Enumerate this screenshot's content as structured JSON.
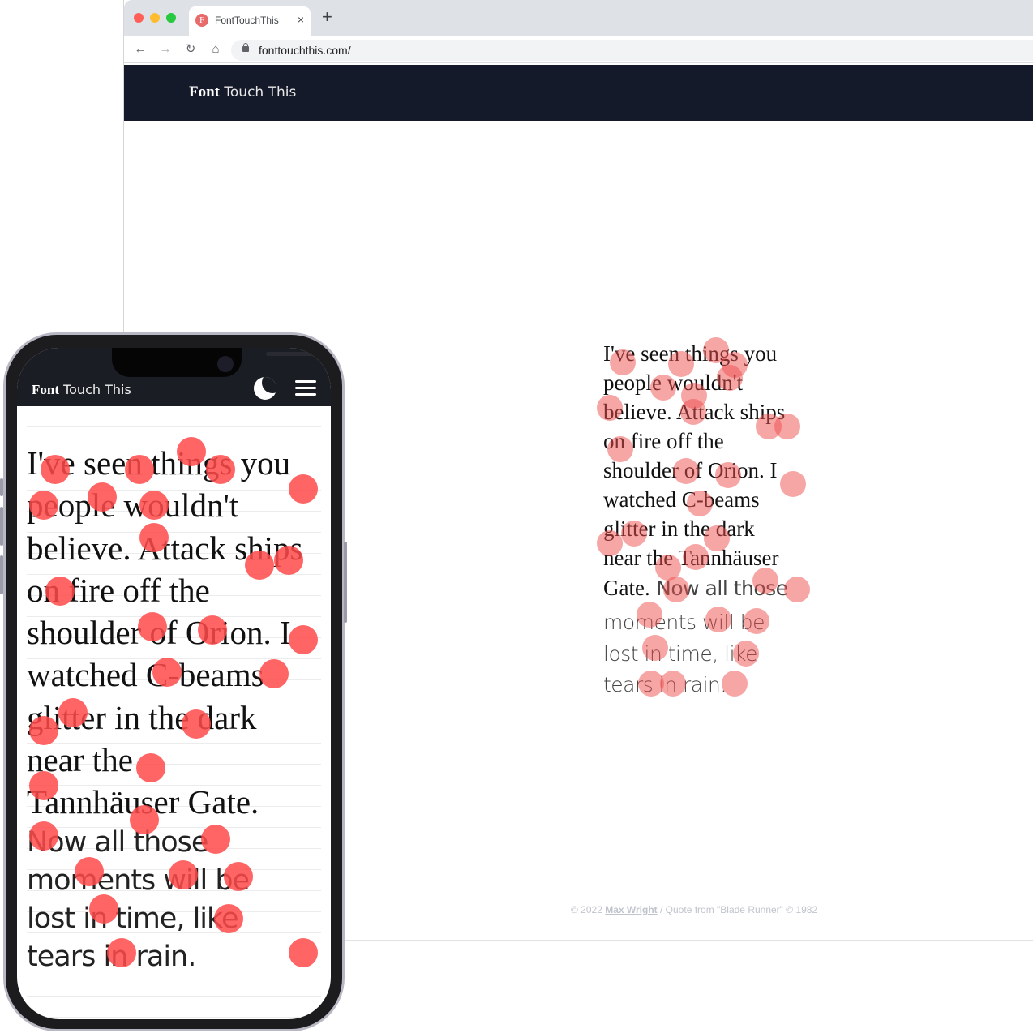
{
  "browser": {
    "tab_title": "FontTouchThis",
    "favicon_letter": "F",
    "close_glyph": "×",
    "new_tab_glyph": "+",
    "url": "fonttouchthis.com/",
    "nav": {
      "back": "←",
      "forward": "→",
      "reload": "↻",
      "home": "⌂"
    }
  },
  "site": {
    "brand_bold": "Font",
    "brand_light": " Touch This",
    "text_serif_lines": [
      "I've seen things you",
      "people wouldn't",
      "believe. Attack ships",
      "on fire off the",
      "shoulder of Orion. I",
      "watched C-beams",
      "glitter in the dark",
      "near the Tannhäuser"
    ],
    "text_mixed": {
      "serif": "Gate.",
      "sans": " Now all those"
    },
    "text_sans_lines": [
      "moments will be",
      "lost in time, like",
      "tears in rain."
    ],
    "footer": {
      "prefix": "© 2022 ",
      "author": "Max Wright",
      "suffix": " / Quote from \"Blade Runner\" © 1982"
    }
  },
  "phone": {
    "brand_bold": "Font",
    "brand_light": " Touch This",
    "theme_icon": "moon-icon",
    "menu_icon": "hamburger-menu-icon",
    "text_serif_lines": [
      "I've seen things you",
      "people wouldn't",
      "believe. Attack ships",
      "on fire off the",
      "shoulder of Orion. I",
      "watched C-beams",
      "glitter in the dark",
      "near the",
      "Tannhäuser Gate."
    ],
    "text_sans_lines": [
      "Now all those",
      "moments will be",
      "lost in time, like",
      "tears in rain."
    ]
  },
  "colors": {
    "header_bg": "#141a29",
    "touch_dot": "#ff4a4a"
  }
}
